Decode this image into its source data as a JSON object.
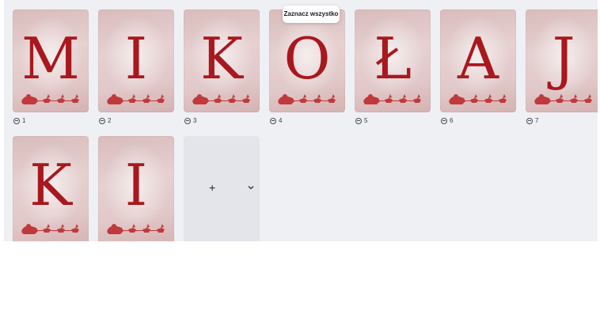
{
  "tooltip": {
    "text": "Zaznacz wszystko"
  },
  "pages": [
    {
      "letter": "M",
      "number": "1"
    },
    {
      "letter": "I",
      "number": "2"
    },
    {
      "letter": "K",
      "number": "3"
    },
    {
      "letter": "O",
      "number": "4"
    },
    {
      "letter": "Ł",
      "number": "5"
    },
    {
      "letter": "A",
      "number": "6"
    },
    {
      "letter": "J",
      "number": "7"
    },
    {
      "letter": "K"
    },
    {
      "letter": "I"
    }
  ],
  "add_page": {
    "plus": "+",
    "icon": "chevron-down-icon"
  },
  "colors": {
    "letter": "#a8181e",
    "canvas": "#eff0f4",
    "card_bg": "#e2c9c9"
  }
}
